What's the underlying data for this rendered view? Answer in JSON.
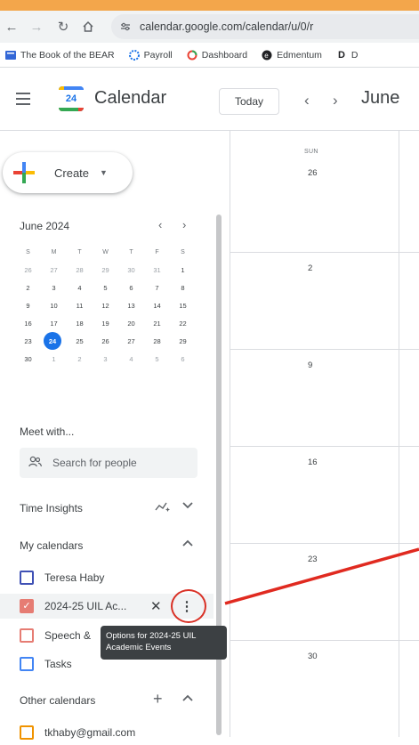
{
  "browser": {
    "url": "calendar.google.com/calendar/u/0/r",
    "bookmarks": [
      {
        "label": "The Book of the BEAR",
        "icon": "book-icon",
        "color": "#3367d6"
      },
      {
        "label": "Payroll",
        "icon": "payroll-icon",
        "color": "#1a73e8"
      },
      {
        "label": "Dashboard",
        "icon": "dashboard-icon",
        "color": "#ea4335"
      },
      {
        "label": "Edmentum",
        "icon": "edmentum-icon",
        "color": "#202124"
      },
      {
        "label": "D",
        "icon": "d-icon",
        "color": "#202124"
      }
    ]
  },
  "header": {
    "app_title": "Calendar",
    "logo_day": "24",
    "today_label": "Today",
    "month_title": "June"
  },
  "sidebar": {
    "create_label": "Create",
    "minical": {
      "title": "June 2024",
      "weekdays": [
        "S",
        "M",
        "T",
        "W",
        "T",
        "F",
        "S"
      ],
      "weeks": [
        [
          "26",
          "27",
          "28",
          "29",
          "30",
          "31",
          "1"
        ],
        [
          "2",
          "3",
          "4",
          "5",
          "6",
          "7",
          "8"
        ],
        [
          "9",
          "10",
          "11",
          "12",
          "13",
          "14",
          "15"
        ],
        [
          "16",
          "17",
          "18",
          "19",
          "20",
          "21",
          "22"
        ],
        [
          "23",
          "24",
          "25",
          "26",
          "27",
          "28",
          "29"
        ],
        [
          "30",
          "1",
          "2",
          "3",
          "4",
          "5",
          "6"
        ]
      ],
      "today": "24"
    },
    "meet_with": "Meet with...",
    "search_people_placeholder": "Search for people",
    "time_insights": "Time Insights",
    "my_calendars_label": "My calendars",
    "my_calendars": [
      {
        "name": "Teresa Haby",
        "color": "#3f51b5",
        "checked": false
      },
      {
        "name": "2024-25 UIL Ac...",
        "color": "#e67c73",
        "checked": true
      },
      {
        "name": "Speech &",
        "color": "#e67c73",
        "checked": false
      },
      {
        "name": "Tasks",
        "color": "#4285f4",
        "checked": false
      }
    ],
    "tooltip": "Options for 2024-25 UIL Academic Events",
    "other_calendars_label": "Other calendars",
    "other_calendars": [
      {
        "name": "tkhaby@gmail.com",
        "color": "#f09300",
        "checked": false
      }
    ]
  },
  "grid": {
    "day_header": "SUN",
    "week_days": [
      "26",
      "2",
      "9",
      "16",
      "23",
      "30"
    ]
  },
  "colors": {
    "accent": "#1a73e8",
    "annotation_red": "#d93025",
    "top_strip": "#f3a64b"
  }
}
